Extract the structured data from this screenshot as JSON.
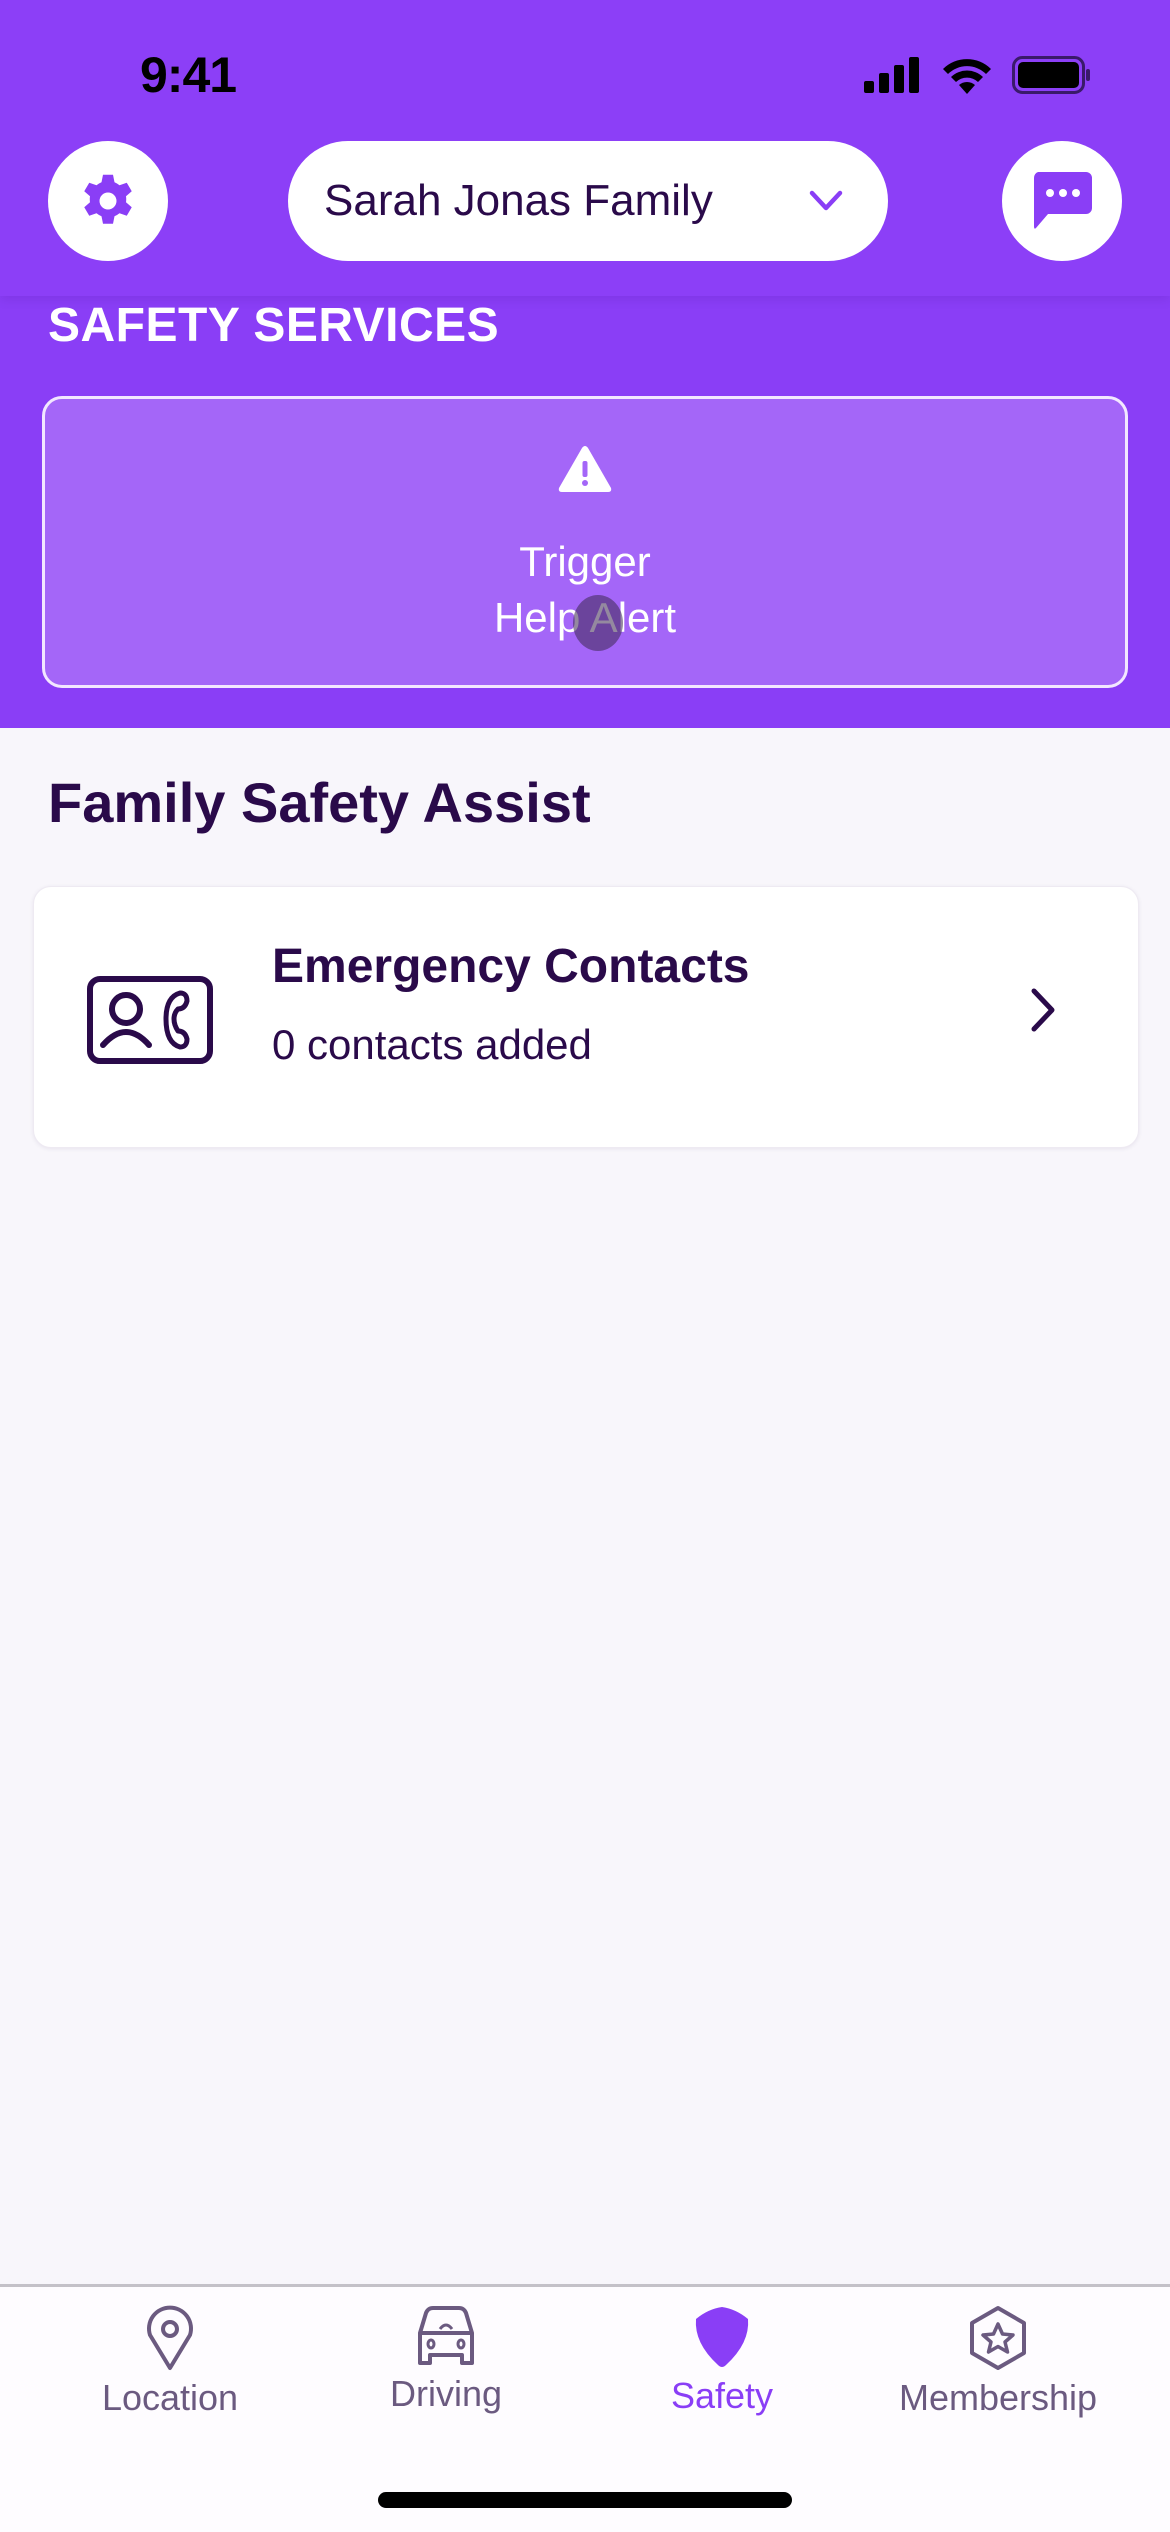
{
  "status_bar": {
    "time": "9:41",
    "icons": [
      "cellular-signal-icon",
      "wifi-icon",
      "battery-icon"
    ]
  },
  "header": {
    "settings_icon": "gear-icon",
    "family_selector": {
      "selected": "Sarah Jonas Family",
      "icon": "chevron-down-icon"
    },
    "chat_icon": "chat-bubble-icon"
  },
  "safety_services": {
    "title": "SAFETY SERVICES",
    "help_alert": {
      "icon": "warning-triangle-icon",
      "line1": "Trigger",
      "line2": "Help Alert"
    }
  },
  "family_safety_assist": {
    "title": "Family Safety Assist",
    "items": [
      {
        "icon": "contact-card-phone-icon",
        "title": "Emergency Contacts",
        "subtitle": "0 contacts added",
        "action_icon": "chevron-right-icon"
      }
    ]
  },
  "tabbar": {
    "tabs": [
      {
        "label": "Location",
        "icon": "location-pin-icon",
        "active": false
      },
      {
        "label": "Driving",
        "icon": "car-icon",
        "active": false
      },
      {
        "label": "Safety",
        "icon": "shield-icon",
        "active": true
      },
      {
        "label": "Membership",
        "icon": "star-badge-icon",
        "active": false
      }
    ]
  },
  "colors": {
    "brand": "#8c3ff7",
    "card_purple": "#a466f8",
    "text_dark": "#2a0a4a",
    "tab_inactive": "#6b5a80"
  }
}
